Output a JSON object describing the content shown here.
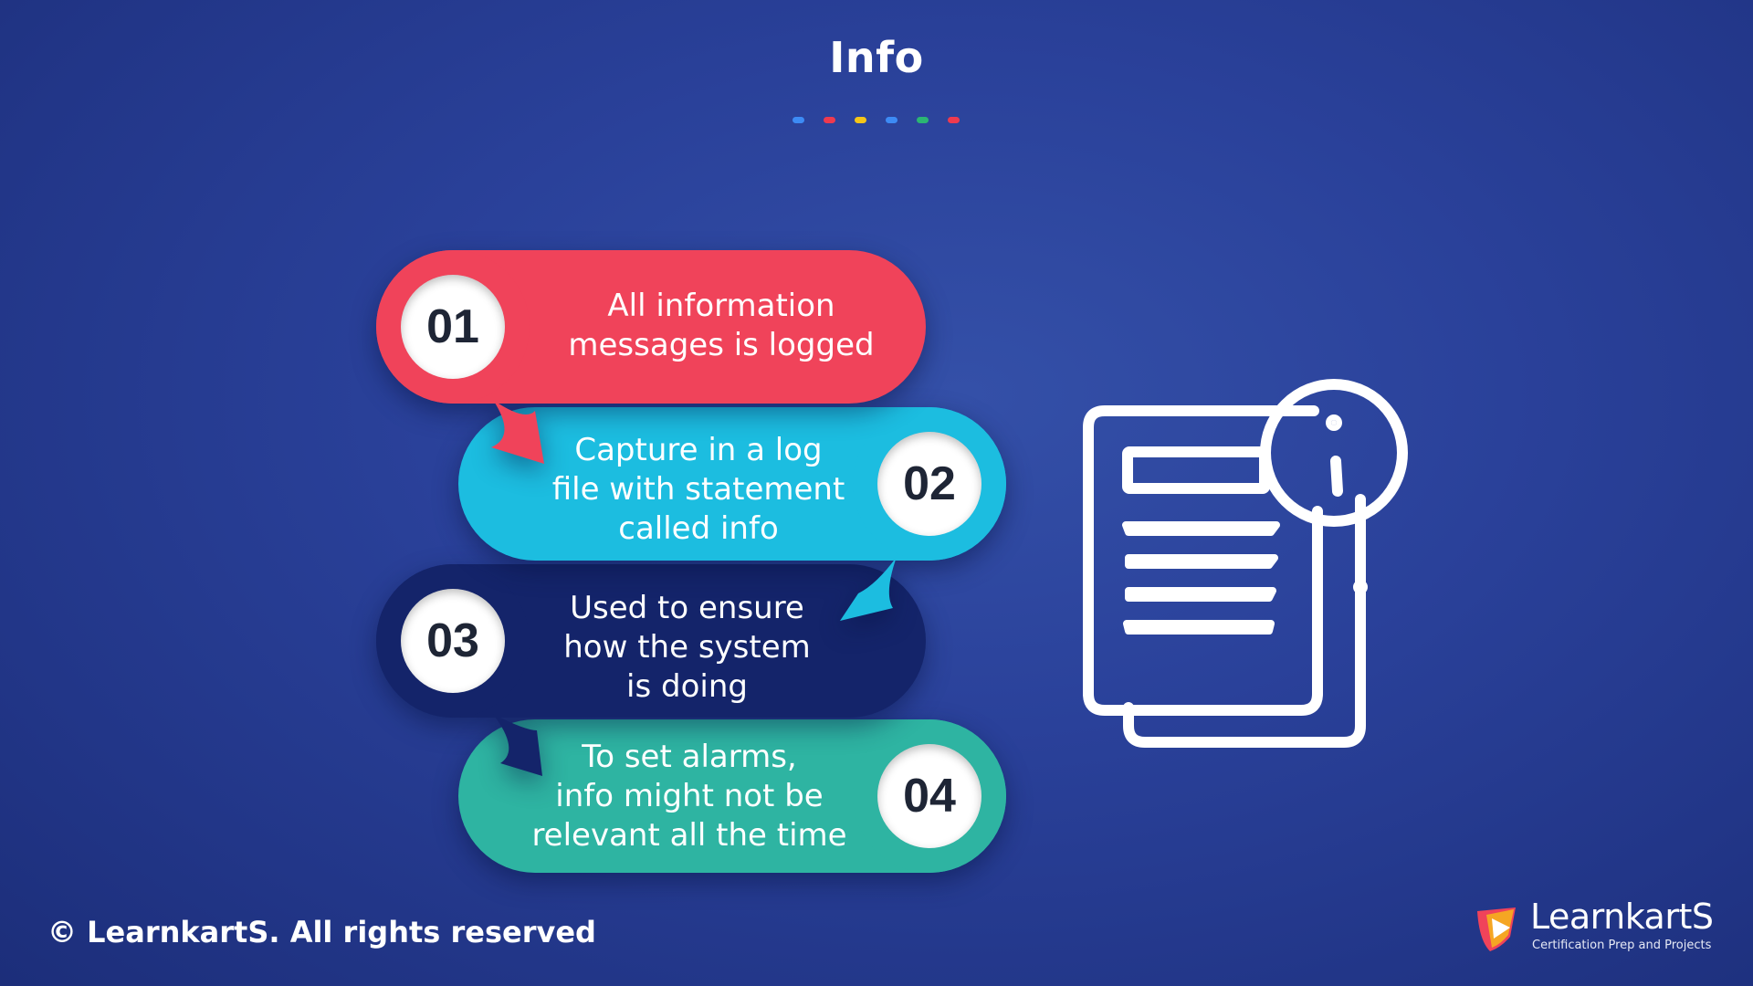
{
  "slide": {
    "title": "Info",
    "dot_colors": [
      "#3d8bf5",
      "#ee3a4f",
      "#f5c518",
      "#3d8bf5",
      "#2bb673",
      "#ee3a4f"
    ]
  },
  "steps": [
    {
      "number": "01",
      "text": "All information\nmessages is logged",
      "color": "#f0435a"
    },
    {
      "number": "02",
      "text": "Capture in a log\nfile with statement\ncalled info",
      "color": "#1cbde0"
    },
    {
      "number": "03",
      "text": "Used to ensure\nhow the system\nis doing",
      "color": "#14246a"
    },
    {
      "number": "04",
      "text": "To set alarms,\ninfo might not be\nrelevant all the time",
      "color": "#2eb4a2"
    }
  ],
  "icons": {
    "main": "document-info-icon",
    "logo": "learnkarts-logo-icon"
  },
  "footer": {
    "copyright": "© LearnkartS. All rights reserved",
    "brand_name": "LearnkartS",
    "brand_tagline": "Certification Prep and Projects"
  }
}
